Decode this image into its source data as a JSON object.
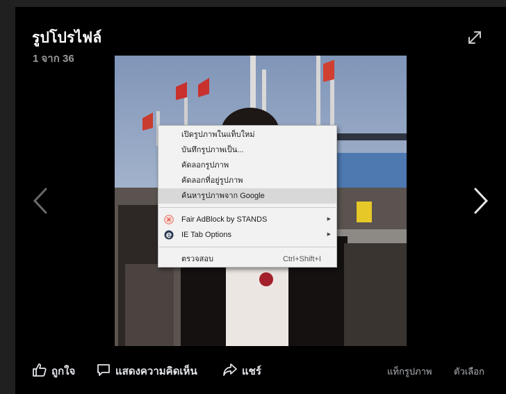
{
  "viewer": {
    "title": "รูปโปรไฟล์",
    "counter": "1 จาก 36"
  },
  "context_menu": {
    "items": [
      {
        "label": "เปิดรูปภาพในแท็บใหม่"
      },
      {
        "label": "บันทึกรูปภาพเป็น..."
      },
      {
        "label": "คัดลอกรูปภาพ"
      },
      {
        "label": "คัดลอกที่อยู่รูปภาพ"
      },
      {
        "label": "ค้นหารูปภาพจาก Google",
        "highlighted": true
      },
      {
        "label": "Fair AdBlock by STANDS",
        "icon": "stands-shield-icon",
        "submenu": true
      },
      {
        "label": "IE Tab Options",
        "icon": "ie-tab-icon",
        "submenu": true
      },
      {
        "label": "ตรวจสอบ",
        "shortcut": "Ctrl+Shift+I"
      }
    ]
  },
  "actions": {
    "like": "ถูกใจ",
    "comment": "แสดงความคิดเห็น",
    "share": "แชร์",
    "tag_photo": "แท็กรูปภาพ",
    "options": "ตัวเลือก"
  },
  "colors": {
    "background": "#000000",
    "menu_background": "#f2f2f2",
    "menu_highlight": "#d8d8d8",
    "action_text": "#e4e6eb",
    "muted_text": "#9a9a9a"
  }
}
